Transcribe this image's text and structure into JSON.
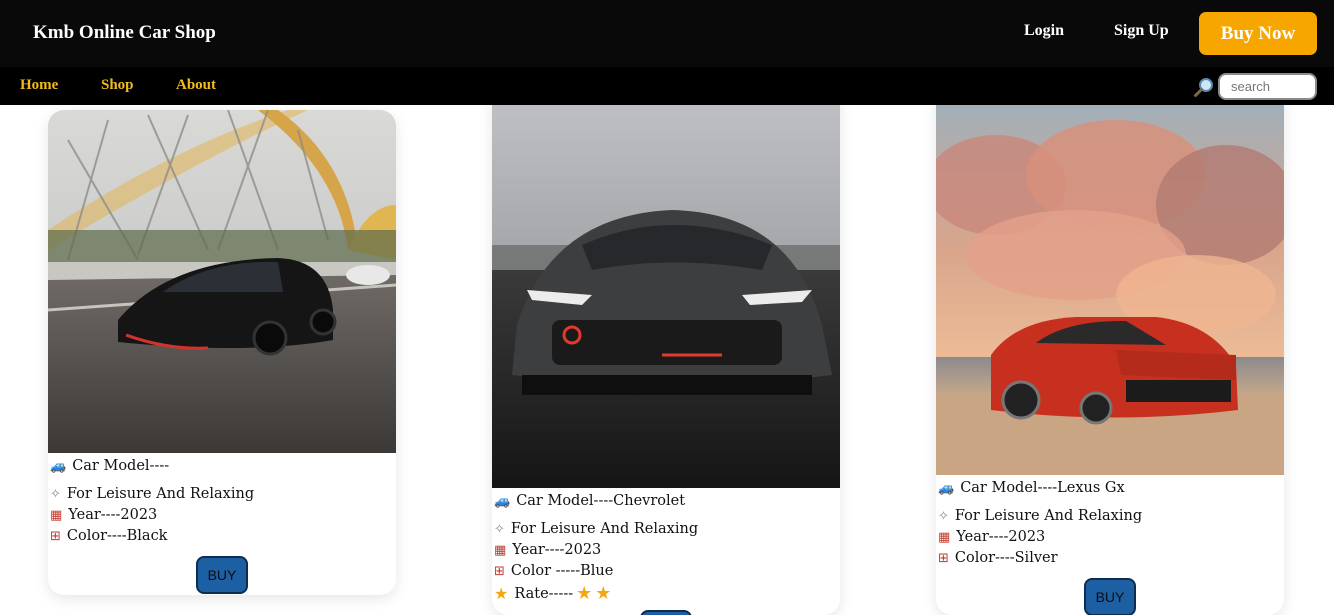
{
  "header": {
    "brand": "Kmb Online Car Shop",
    "login_label": "Login",
    "signup_label": "Sign Up",
    "buy_now_label": "Buy Now"
  },
  "nav": {
    "items": [
      "Home",
      "Shop",
      "About"
    ],
    "search_placeholder": "search"
  },
  "cards": [
    {
      "model": "Car Model----",
      "purpose": "For Leisure And Relaxing",
      "year": "Year----2023",
      "color": "Color----Black",
      "buy_label": "BUY"
    },
    {
      "model": "Car Model----Chevrolet",
      "purpose": "For Leisure And Relaxing",
      "year": "Year----2023",
      "color": "Color -----Blue",
      "rate": "Rate-----",
      "rating_stars": 2
    },
    {
      "model": "Car Model----Lexus Gx",
      "purpose": "For Leisure And Relaxing",
      "year": "Year----2023",
      "color": "Color----Silver",
      "buy_label": "BUY"
    }
  ],
  "colors": {
    "topbar": "#090909",
    "accent": "#f7a600",
    "nav_link": "#f1bd1b",
    "buy_button": "#1d5fa3"
  }
}
